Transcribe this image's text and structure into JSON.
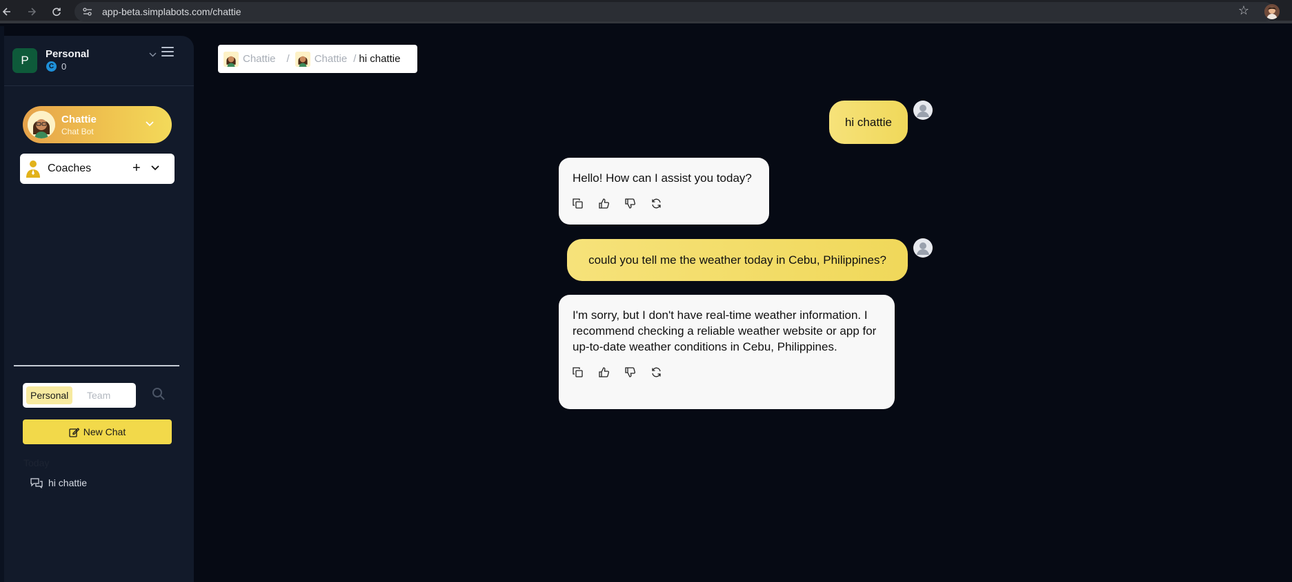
{
  "browser": {
    "url": "app-beta.simplabots.com/chattie"
  },
  "sidebar": {
    "workspace": {
      "initial": "P",
      "name": "Personal",
      "credit_badge": "C",
      "credits": "0"
    },
    "bot": {
      "name": "Chattie",
      "subtitle": "Chat Bot"
    },
    "coaches": {
      "label": "Coaches",
      "add_symbol": "+"
    },
    "tabs": {
      "personal": "Personal",
      "team": "Team"
    },
    "new_chat_label": "New Chat",
    "history": {
      "group_label": "Today",
      "items": [
        "hi chattie"
      ]
    }
  },
  "breadcrumb": {
    "items": [
      "Chattie",
      "Chattie"
    ],
    "separator": "/",
    "current": "hi chattie"
  },
  "messages": [
    {
      "role": "user",
      "text": "hi chattie"
    },
    {
      "role": "bot",
      "text": "Hello! How can I assist you today?"
    },
    {
      "role": "user",
      "text": "could you tell me the weather today in Cebu, Philippines?"
    },
    {
      "role": "bot",
      "text": "I'm sorry, but I don't have real-time weather information. I recommend checking a reliable weather website or app for up-to-date weather conditions in Cebu, Philippines."
    }
  ],
  "colors": {
    "accent_yellow": "#f2d94a",
    "sidebar_bg": "#121a2a",
    "page_bg": "#060a14"
  },
  "icons": [
    "back-arrow-icon",
    "forward-arrow-icon",
    "reload-icon",
    "site-settings-icon",
    "star-icon",
    "copy-icon",
    "thumbs-up-icon",
    "thumbs-down-icon",
    "regenerate-icon",
    "search-icon",
    "edit-icon",
    "chat-bubbles-icon"
  ]
}
